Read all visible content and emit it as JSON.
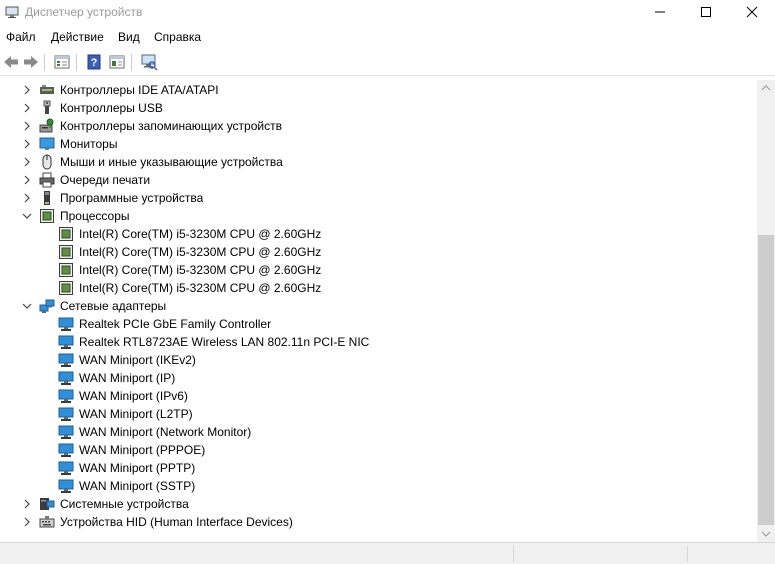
{
  "window": {
    "title": "Диспетчер устройств"
  },
  "menu": {
    "file": "Файл",
    "action": "Действие",
    "view": "Вид",
    "help": "Справка"
  },
  "tree": {
    "ide": "Контроллеры IDE ATA/ATAPI",
    "usb": "Контроллеры USB",
    "storage": "Контроллеры запоминающих устройств",
    "monitors": "Мониторы",
    "mice": "Мыши и иные указывающие устройства",
    "print_queues": "Очереди печати",
    "software": "Программные устройства",
    "processors": {
      "label": "Процессоры",
      "items": [
        "Intel(R) Core(TM) i5-3230M CPU @ 2.60GHz",
        "Intel(R) Core(TM) i5-3230M CPU @ 2.60GHz",
        "Intel(R) Core(TM) i5-3230M CPU @ 2.60GHz",
        "Intel(R) Core(TM) i5-3230M CPU @ 2.60GHz"
      ]
    },
    "network": {
      "label": "Сетевые адаптеры",
      "items": [
        "Realtek PCIe GbE Family Controller",
        "Realtek RTL8723AE Wireless LAN 802.11n PCI-E NIC",
        "WAN Miniport (IKEv2)",
        "WAN Miniport (IP)",
        "WAN Miniport (IPv6)",
        "WAN Miniport (L2TP)",
        "WAN Miniport (Network Monitor)",
        "WAN Miniport (PPPOE)",
        "WAN Miniport (PPTP)",
        "WAN Miniport (SSTP)"
      ]
    },
    "system": "Системные устройства",
    "hid": "Устройства HID (Human Interface Devices)"
  },
  "icons": {
    "app": "device-manager-icon",
    "back": "back-arrow-icon",
    "forward": "forward-arrow-icon",
    "properties": "properties-icon",
    "help": "help-icon",
    "show_hidden": "view-grid-icon",
    "scan": "scan-hardware-icon"
  },
  "colors": {
    "title_text": "#9a9a9a",
    "network_icon": "#2f8fd8",
    "processor_icon": "#4d7a3a",
    "scroll_thumb": "#cdcdcd"
  }
}
